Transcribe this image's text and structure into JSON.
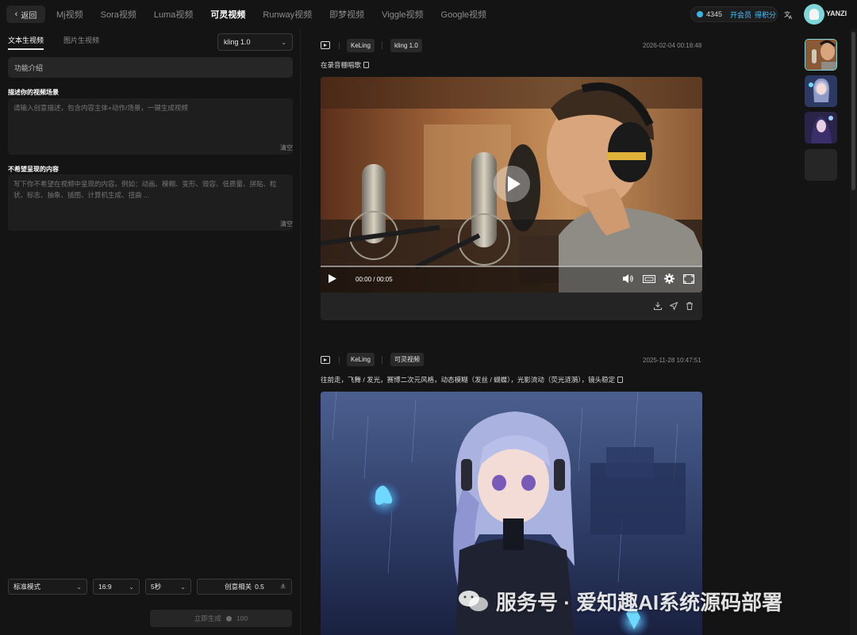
{
  "topbar": {
    "back_label": "返回",
    "tabs": [
      "Mj视频",
      "Sora视频",
      "Luma视频",
      "可灵视频",
      "Runway视频",
      "即梦视频",
      "Viggle视频",
      "Google视频"
    ],
    "active_tab": "可灵视频",
    "credits": "4345",
    "vip_label": "开会员",
    "get_points_label": "得积分",
    "username": "YANZI",
    "translate_icon": "translate-icon"
  },
  "left": {
    "subtabs": [
      "文本生视频",
      "图片生视频"
    ],
    "model": "kling 1.0",
    "feature_intro": "功能介绍",
    "describe_label": "描述你的视频场景",
    "describe_placeholder": "请输入创意描述，包含内容主体+动作/场景，一键生成视频",
    "clear_label": "清空",
    "negative_label": "不希望呈现的内容",
    "negative_placeholder": "写下你不希望在视频中呈现的内容。例如：动画、模糊、变形、毁容、低质量、拼贴、粒状、标志、抽象、插图、计算机生成、扭曲 ...",
    "mode": "标准模式",
    "ratio": "16:9",
    "duration": "5秒",
    "creativity_label": "创意相关",
    "creativity_value": "0.5",
    "generate_label": "立即生成",
    "generate_cost": "100"
  },
  "feed": {
    "card1": {
      "tags": [
        "KeLing",
        "kling 1.0"
      ],
      "timestamp": "2026-02-04 00:18:48",
      "prompt": "在录音棚唱歌",
      "time": "00:00 / 00:05"
    },
    "card2": {
      "tags": [
        "KeLing",
        "可灵视频"
      ],
      "timestamp": "2025-11-28 10:47:51",
      "prompt": "往前走，飞舞 / 发光，赛博二次元风格，动态模糊（发丝 / 蝴蝶），光影流动（荧光涟漪），镜头稳定"
    }
  },
  "watermark": {
    "text": "服务号 · 爱知趣AI系统源码部署"
  }
}
